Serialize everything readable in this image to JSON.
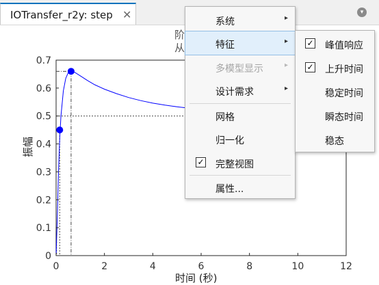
{
  "tab": {
    "title": "IOTransfer_r2y: step",
    "close_glyph": "✕"
  },
  "plot": {
    "title_line1": "阶",
    "title_line2": "从",
    "ylabel": "振幅",
    "xlabel": "时间 (秒)"
  },
  "chart_data": {
    "type": "line",
    "xlim": [
      0,
      12
    ],
    "ylim": [
      0,
      0.7
    ],
    "xticks": [
      "0",
      "2",
      "4",
      "6",
      "8",
      "10",
      "12"
    ],
    "yticks": [
      "0",
      "0.1",
      "0.2",
      "0.3",
      "0.4",
      "0.5",
      "0.6",
      "0.7"
    ],
    "line_color": "#0000ff",
    "series": [
      {
        "x": [
          0,
          0.05,
          0.1,
          0.15,
          0.2,
          0.3,
          0.4,
          0.5,
          0.6,
          0.7,
          0.8,
          1,
          1.3,
          1.6,
          2,
          2.5,
          3,
          3.5,
          4,
          4.5,
          5,
          5.5,
          6
        ],
        "y": [
          0,
          0.14,
          0.3,
          0.42,
          0.5,
          0.59,
          0.635,
          0.655,
          0.66,
          0.659,
          0.655,
          0.644,
          0.627,
          0.612,
          0.596,
          0.58,
          0.566,
          0.555,
          0.546,
          0.539,
          0.533,
          0.528,
          0.524
        ]
      }
    ],
    "markers": [
      {
        "name": "rise",
        "x": 0.15,
        "y": 0.45
      },
      {
        "name": "peak",
        "x": 0.62,
        "y": 0.66
      }
    ],
    "final_value": 0.5,
    "grid": false
  },
  "menu": {
    "items": [
      {
        "label": "系统",
        "submenu": true
      },
      {
        "label": "特征",
        "submenu": true,
        "highlighted": true
      },
      {
        "label": "多模型显示",
        "submenu": true,
        "disabled": true
      },
      {
        "label": "设计需求",
        "submenu": true
      },
      {
        "label": "网格",
        "checked": false
      },
      {
        "label": "归一化",
        "checked": false
      },
      {
        "label": "完整视图",
        "checked": true
      },
      {
        "label": "属性..."
      }
    ]
  },
  "submenu": {
    "items": [
      {
        "label": "峰值响应",
        "checked": true
      },
      {
        "label": "上升时间",
        "checked": true
      },
      {
        "label": "稳定时间",
        "checked": false
      },
      {
        "label": "瞬态时间",
        "checked": false
      },
      {
        "label": "稳态",
        "checked": false
      }
    ]
  },
  "glyphs": {
    "check": "✓",
    "arrow": "▸",
    "dropdown": "▾"
  }
}
